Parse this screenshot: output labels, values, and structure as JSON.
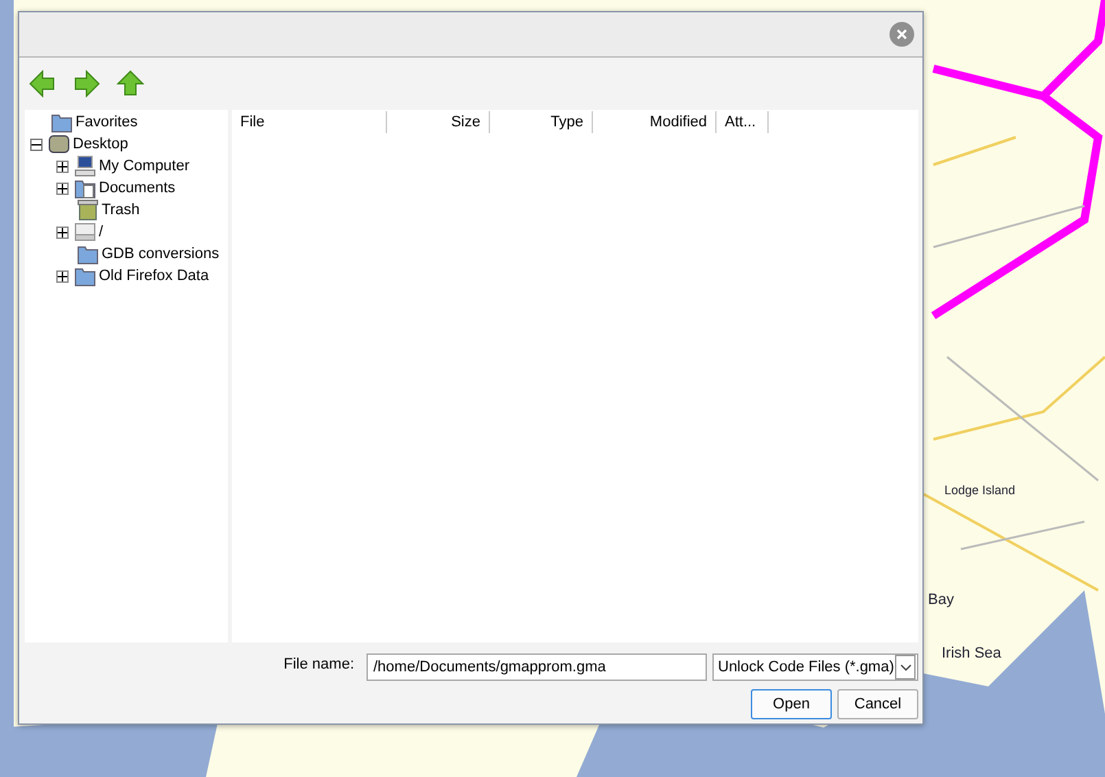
{
  "map": {
    "labels": [
      {
        "text": "Lodge Island",
        "kind": "place"
      },
      {
        "text": "Bay",
        "kind": "water"
      },
      {
        "text": "Irish Sea",
        "kind": "water"
      }
    ]
  },
  "dialog": {
    "toolbar": [
      {
        "kind": "back"
      },
      {
        "kind": "forward"
      },
      {
        "kind": "up"
      }
    ],
    "tree": [
      {
        "label": "Favorites",
        "kind": "folder"
      },
      {
        "label": "Desktop",
        "kind": "desktop",
        "expanded": true,
        "children": [
          {
            "label": "My Computer",
            "kind": "computer",
            "expanded": false
          },
          {
            "label": "Documents",
            "kind": "documents",
            "expanded": false
          },
          {
            "label": "Trash",
            "kind": "trash"
          },
          {
            "label": "/",
            "kind": "drive",
            "expanded": false
          },
          {
            "label": "GDB conversions",
            "kind": "folder"
          },
          {
            "label": "Old Firefox Data",
            "kind": "folder",
            "expanded": false
          }
        ]
      }
    ],
    "columns": [
      "File",
      "Size",
      "Type",
      "Modified",
      "Att..."
    ],
    "file_name_label": "File name:",
    "file_name": "/home/Documents/gmapprom.gma",
    "file_type": "Unlock Code Files (*.gma)",
    "buttons": [
      {
        "label": "Open",
        "default": true
      },
      {
        "label": "Cancel",
        "default": false
      }
    ]
  }
}
